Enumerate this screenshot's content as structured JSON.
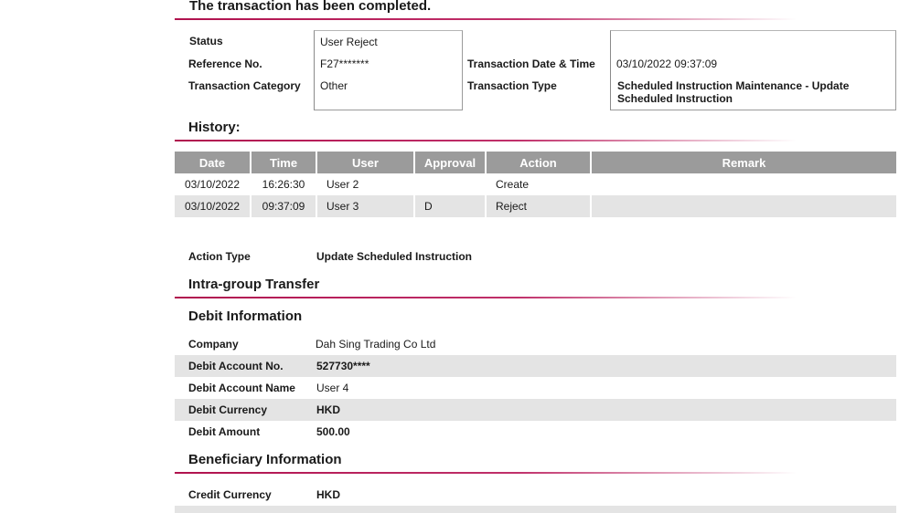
{
  "header": {
    "title": "The transaction has been completed."
  },
  "summary": {
    "status_label": "Status",
    "status_value": "User Reject",
    "reference_label": "Reference No.",
    "reference_value": "F27*******",
    "category_label": "Transaction Category",
    "category_value": "Other",
    "datetime_label": "Transaction Date & Time",
    "datetime_value": "03/10/2022 09:37:09",
    "type_label": "Transaction Type",
    "type_value_line1": "Scheduled Instruction Maintenance - Update",
    "type_value_line2": "Scheduled Instruction"
  },
  "history": {
    "heading": "History:",
    "columns": [
      "Date",
      "Time",
      "User",
      "Approval",
      "Action",
      "Remark"
    ],
    "rows": [
      {
        "date": "03/10/2022",
        "time": "16:26:30",
        "user": "User 2",
        "approval": "",
        "action": "Create",
        "remark": ""
      },
      {
        "date": "03/10/2022",
        "time": "09:37:09",
        "user": "User 3",
        "approval": "D",
        "action": "Reject",
        "remark": ""
      }
    ]
  },
  "action_type": {
    "label": "Action Type",
    "value": "Update Scheduled Instruction"
  },
  "transfer": {
    "heading": "Intra-group Transfer"
  },
  "debit": {
    "heading": "Debit Information",
    "company_label": "Company",
    "company_value": "Dah Sing Trading Co Ltd",
    "account_no_label": "Debit Account No.",
    "account_no_value": "527730****",
    "account_name_label": "Debit Account Name",
    "account_name_value": "User 4",
    "currency_label": "Debit Currency",
    "currency_value": "HKD",
    "amount_label": "Debit Amount",
    "amount_value": "500.00"
  },
  "beneficiary": {
    "heading": "Beneficiary Information",
    "credit_currency_label": "Credit Currency",
    "credit_currency_value": "HKD"
  },
  "colors": {
    "accent": "#b0124e",
    "table_header": "#9b9b9b",
    "row_alt": "#e4e4e4"
  }
}
